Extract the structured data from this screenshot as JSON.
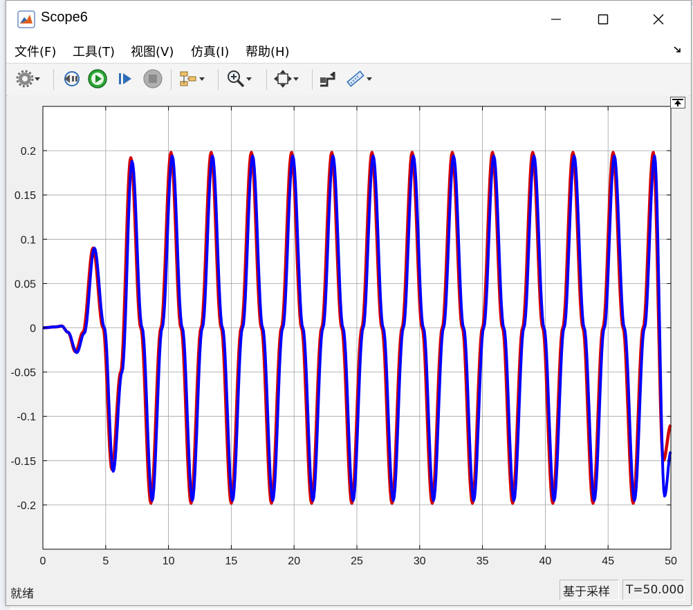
{
  "window": {
    "title": "Scope6"
  },
  "menu": {
    "items": [
      {
        "label": "文件(F)"
      },
      {
        "label": "工具(T)"
      },
      {
        "label": "视图(V)"
      },
      {
        "label": "仿真(I)"
      },
      {
        "label": "帮助(H)"
      }
    ]
  },
  "toolbar": {
    "buttons": [
      {
        "icon": "gear-icon",
        "dropdown": true
      },
      {
        "icon": "step-back-icon",
        "dropdown": false
      },
      {
        "icon": "run-icon",
        "dropdown": false
      },
      {
        "icon": "step-forward-icon",
        "dropdown": false
      },
      {
        "icon": "stop-icon",
        "dropdown": false
      },
      {
        "icon": "signal-hierarchy-icon",
        "dropdown": true
      },
      {
        "icon": "zoom-in-icon",
        "dropdown": true
      },
      {
        "icon": "autoscale-icon",
        "dropdown": true
      },
      {
        "icon": "highlight-block-icon",
        "dropdown": false
      },
      {
        "icon": "measurement-icon",
        "dropdown": true
      }
    ]
  },
  "status": {
    "state": "就绪",
    "sample_mode": "基于采样",
    "time": "T=50.000"
  },
  "chart_data": {
    "type": "line",
    "title": "",
    "xlabel": "",
    "ylabel": "",
    "xlim": [
      0,
      50
    ],
    "ylim": [
      -0.25,
      0.25
    ],
    "xticks": [
      0,
      5,
      10,
      15,
      20,
      25,
      30,
      35,
      40,
      45,
      50
    ],
    "yticks": [
      0.2,
      0.15,
      0.1,
      0.05,
      0,
      -0.05,
      -0.1,
      -0.15,
      -0.2
    ],
    "ytick_labels": [
      "0.2",
      "0.15",
      "0.1",
      "0.05",
      "0",
      "-0.05",
      "-0.1",
      "-0.15",
      "-0.2"
    ],
    "grid": true,
    "colors": {
      "background": "#ffffff",
      "grid": "#a0a0a0",
      "axes": "#000000"
    },
    "series": [
      {
        "color": "#d40000",
        "x": [
          0,
          1,
          1.5,
          2,
          2.6,
          3.2,
          4.0,
          4.8,
          5.5,
          6.2,
          7.0,
          7.8,
          8.6,
          9.4,
          10.2,
          11.0,
          11.8,
          12.6,
          13.4,
          14.2,
          15.0,
          15.8,
          16.6,
          17.4,
          18.2,
          19.0,
          19.8,
          20.6,
          21.4,
          22.2,
          23.0,
          23.8,
          24.6,
          25.4,
          26.2,
          27.0,
          27.8,
          28.6,
          29.4,
          30.2,
          31.0,
          31.8,
          32.6,
          33.4,
          34.2,
          35.0,
          35.8,
          36.6,
          37.4,
          38.2,
          39.0,
          39.8,
          40.6,
          41.4,
          42.2,
          43.0,
          43.8,
          44.6,
          45.4,
          46.2,
          47.0,
          47.8,
          48.6,
          49.4,
          50.0
        ],
        "y": [
          0,
          0.001,
          0.002,
          -0.005,
          -0.027,
          -0.005,
          0.09,
          0.0,
          -0.16,
          -0.05,
          0.192,
          0.0,
          -0.198,
          0.0,
          0.198,
          0.0,
          -0.198,
          0.0,
          0.198,
          0.0,
          -0.198,
          0.0,
          0.198,
          0.0,
          -0.198,
          0.0,
          0.198,
          0.0,
          -0.198,
          0.0,
          0.198,
          0.0,
          -0.198,
          0.0,
          0.198,
          0.0,
          -0.198,
          0.0,
          0.198,
          0.0,
          -0.198,
          0.0,
          0.198,
          0.0,
          -0.198,
          0.0,
          0.198,
          0.0,
          -0.198,
          0.0,
          0.198,
          0.0,
          -0.198,
          0.0,
          0.198,
          0.0,
          -0.198,
          0.0,
          0.198,
          0.0,
          -0.198,
          0.0,
          0.198,
          -0.15,
          -0.11
        ]
      },
      {
        "color": "#0000ff",
        "x": [
          0,
          1,
          1.5,
          2,
          2.7,
          3.3,
          4.1,
          4.9,
          5.6,
          6.3,
          7.1,
          7.9,
          8.7,
          9.5,
          10.3,
          11.1,
          11.9,
          12.7,
          13.5,
          14.3,
          15.1,
          15.9,
          16.7,
          17.5,
          18.3,
          19.1,
          19.9,
          20.7,
          21.5,
          22.3,
          23.1,
          23.9,
          24.7,
          25.5,
          26.3,
          27.1,
          27.9,
          28.7,
          29.5,
          30.3,
          31.1,
          31.9,
          32.7,
          33.5,
          34.3,
          35.1,
          35.9,
          36.7,
          37.5,
          38.3,
          39.1,
          39.9,
          40.7,
          41.5,
          42.3,
          43.1,
          43.9,
          44.7,
          45.5,
          46.3,
          47.1,
          47.9,
          48.7,
          49.5,
          50.0
        ],
        "y": [
          0,
          0.001,
          0.002,
          -0.005,
          -0.028,
          -0.006,
          0.09,
          0.0,
          -0.162,
          -0.05,
          0.188,
          0.0,
          -0.195,
          0.0,
          0.194,
          0.0,
          -0.195,
          0.0,
          0.194,
          0.0,
          -0.195,
          0.0,
          0.194,
          0.0,
          -0.195,
          0.0,
          0.194,
          0.0,
          -0.195,
          0.0,
          0.194,
          0.0,
          -0.195,
          0.0,
          0.194,
          0.0,
          -0.195,
          0.0,
          0.194,
          0.0,
          -0.195,
          0.0,
          0.194,
          0.0,
          -0.195,
          0.0,
          0.194,
          0.0,
          -0.195,
          0.0,
          0.194,
          0.0,
          -0.195,
          0.0,
          0.194,
          0.0,
          -0.195,
          0.0,
          0.194,
          0.0,
          -0.195,
          0.0,
          0.194,
          -0.19,
          -0.14
        ]
      }
    ]
  }
}
